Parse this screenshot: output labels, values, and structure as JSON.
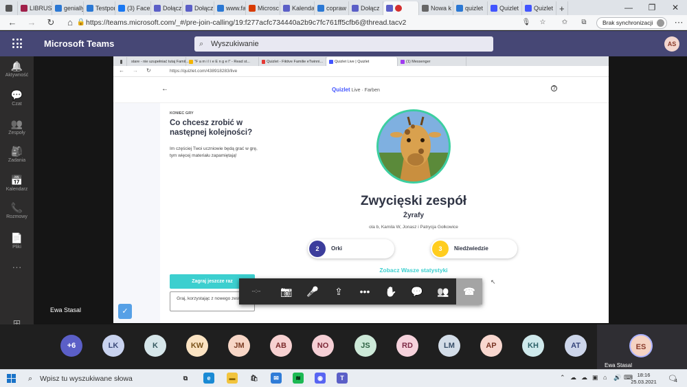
{
  "browser_tabs": [
    {
      "label": "",
      "icon": "tab-actions-icon",
      "color": "#555555"
    },
    {
      "label": "LIBRUS",
      "icon": "librus-icon",
      "color": "#a0204a"
    },
    {
      "label": "genially",
      "icon": "bing-icon",
      "color": "#2b78d4"
    },
    {
      "label": "Testpor",
      "icon": "bing-icon",
      "color": "#2b78d4"
    },
    {
      "label": "(3) Face",
      "icon": "facebook-icon",
      "color": "#1877f2"
    },
    {
      "label": "Dołącz",
      "icon": "teams-icon",
      "color": "#5b5fc7"
    },
    {
      "label": "Dołącz",
      "icon": "teams-icon",
      "color": "#5b5fc7"
    },
    {
      "label": "www.fa",
      "icon": "bing-icon",
      "color": "#2b78d4"
    },
    {
      "label": "Microsc",
      "icon": "office-icon",
      "color": "#d83b01"
    },
    {
      "label": "Kalenda",
      "icon": "teams-icon",
      "color": "#5b5fc7"
    },
    {
      "label": "copraw",
      "icon": "bing-icon",
      "color": "#2b78d4"
    },
    {
      "label": "Dołącz",
      "icon": "teams-icon",
      "color": "#5b5fc7"
    },
    {
      "label": "",
      "icon": "teams-icon",
      "color": "#5b5fc7",
      "active": true
    },
    {
      "label": "Nowa k",
      "icon": "new-tab-icon",
      "color": "#666666"
    },
    {
      "label": "quizlet",
      "icon": "bing-icon",
      "color": "#2b78d4"
    },
    {
      "label": "Quizlet",
      "icon": "quizlet-icon",
      "color": "#4255ff"
    },
    {
      "label": "Quizlet",
      "icon": "quizlet-icon",
      "color": "#4255ff"
    }
  ],
  "browser": {
    "url": "https://teams.microsoft.com/_#/pre-join-calling/19:f277acfc734440a2b9c7fc761ff5cfb6@thread.tacv2",
    "sync_label": "Brak synchronizacji",
    "new_tab": "+",
    "minimize": "—",
    "maximize": "❐",
    "close": "✕"
  },
  "teams": {
    "title": "Microsoft Teams",
    "search_placeholder": "Wyszukiwanie",
    "user_initials": "AS",
    "rail": [
      {
        "label": "Aktywność",
        "icon": "bell-icon",
        "glyph": "🔔"
      },
      {
        "label": "Czat",
        "icon": "chat-icon",
        "glyph": "💬"
      },
      {
        "label": "Zespoły",
        "icon": "teams-group-icon",
        "glyph": "👥"
      },
      {
        "label": "Zadania",
        "icon": "assignments-icon",
        "glyph": "🎒"
      },
      {
        "label": "Kalendarz",
        "icon": "calendar-icon",
        "glyph": "📅"
      },
      {
        "label": "Rozmowy",
        "icon": "phone-icon",
        "glyph": "📞"
      },
      {
        "label": "Pliki",
        "icon": "files-icon",
        "glyph": "📄"
      },
      {
        "label": "",
        "icon": "more-apps-icon",
        "glyph": "···"
      },
      {
        "label": "Aplikacje",
        "icon": "apps-icon",
        "glyph": "⊞"
      },
      {
        "label": "Pomoc",
        "icon": "help-icon",
        "glyph": "?"
      }
    ],
    "presenter_name": "Ewa Stasal"
  },
  "shared": {
    "inner_tabs": [
      {
        "label": "",
        "color": "#555555"
      },
      {
        "label": "stare - nie uzupełniać tutaj Famil...",
        "color": "#f4b400"
      },
      {
        "label": "\"F a m i l i e  E n g e l\" - Read st...",
        "color": "#f4b400"
      },
      {
        "label": "Quizlet - Fiktive Familie eTwinni...",
        "color": "#e53935"
      },
      {
        "label": "Quizlet Live | Quizlet",
        "color": "#4255ff",
        "active": true
      },
      {
        "label": "(1) Messenger",
        "color": "#a03cf0"
      }
    ],
    "inner_url": "https://quizlet.com/438918283/live",
    "logo_brand": "Quizlet",
    "logo_suffix": "Live · Farben",
    "game_over": "KONIEC GRY",
    "question": "Co chcesz zrobić w następnej kolejności?",
    "description": "Im częściej Twoi uczniowie będą grać w grę, tym więcej materiału zapamiętają!",
    "play_again": "Zagraj jeszcze raz",
    "new_set": "Graj, korzystając z nowego zestawu",
    "winner_title": "Zwycięski zespół",
    "winner_team": "Żyrafy",
    "winner_members": "ola b, Kamila W, Jonasz i Patrycja Gołkowice",
    "others": [
      {
        "rank": "2",
        "name": "Orki",
        "color": "#3c3d9c"
      },
      {
        "rank": "3",
        "name": "Niedźwiedzie",
        "color": "#ffcd1f"
      }
    ],
    "stats_link": "Zobacz Wasze statystyki"
  },
  "call_controls": [
    {
      "name": "call-timer",
      "glyph": "--:--"
    },
    {
      "name": "camera-off-icon",
      "glyph": "📷"
    },
    {
      "name": "mic-icon",
      "glyph": "🎤"
    },
    {
      "name": "share-screen-icon",
      "glyph": "⇪"
    },
    {
      "name": "more-actions-icon",
      "glyph": "•••"
    },
    {
      "name": "raise-hand-icon",
      "glyph": "✋"
    },
    {
      "name": "meeting-chat-icon",
      "glyph": "💬"
    },
    {
      "name": "participants-icon",
      "glyph": "👥"
    },
    {
      "name": "hang-up-icon",
      "glyph": "☎"
    }
  ],
  "participants": [
    {
      "initials": "+6",
      "bg": "#5b5fc7",
      "fg": "#ffffff"
    },
    {
      "initials": "LK",
      "bg": "#c9d3ef",
      "fg": "#3b4a7a"
    },
    {
      "initials": "K",
      "bg": "#d6e6ea",
      "fg": "#34585f"
    },
    {
      "initials": "KW",
      "bg": "#fbe3c2",
      "fg": "#7a5219"
    },
    {
      "initials": "JM",
      "bg": "#f7d6c6",
      "fg": "#7a3b22"
    },
    {
      "initials": "AB",
      "bg": "#f7d1d1",
      "fg": "#7b2a2a"
    },
    {
      "initials": "NO",
      "bg": "#f5cfd5",
      "fg": "#7d2a39"
    },
    {
      "initials": "JS",
      "bg": "#cde9d8",
      "fg": "#2c6041"
    },
    {
      "initials": "RD",
      "bg": "#f6d2dc",
      "fg": "#7d2a46"
    },
    {
      "initials": "LM",
      "bg": "#d3dde8",
      "fg": "#364d67"
    },
    {
      "initials": "AP",
      "bg": "#f8d7cf",
      "fg": "#7a3626"
    },
    {
      "initials": "KH",
      "bg": "#cfe9ec",
      "fg": "#2d6168"
    },
    {
      "initials": "AT",
      "bg": "#cdd6ea",
      "fg": "#34447a"
    }
  ],
  "self": {
    "initials": "ES",
    "name": "Ewa Stasal"
  },
  "taskbar": {
    "search_placeholder": "Wpisz tu wyszukiwane słowa",
    "apps": [
      {
        "name": "task-view-icon",
        "glyph": "⧉",
        "bg": "#e9edf2",
        "fg": "#333333"
      },
      {
        "name": "edge-icon",
        "glyph": "e",
        "bg": "#1a8ad4",
        "fg": "#ffffff"
      },
      {
        "name": "file-explorer-icon",
        "glyph": "▬",
        "bg": "#f2c43d",
        "fg": "#8a6200"
      },
      {
        "name": "store-icon",
        "glyph": "🛍",
        "bg": "#e9edf2",
        "fg": "#333333"
      },
      {
        "name": "mail-icon",
        "glyph": "✉",
        "bg": "#2f7cd7",
        "fg": "#ffffff"
      },
      {
        "name": "spotify-icon",
        "glyph": "≋",
        "bg": "#1db954",
        "fg": "#000000"
      },
      {
        "name": "discord-icon",
        "glyph": "◉",
        "bg": "#5865f2",
        "fg": "#ffffff"
      },
      {
        "name": "teams-app-icon",
        "glyph": "T",
        "bg": "#5b5fc7",
        "fg": "#ffffff"
      }
    ],
    "time": "18:16",
    "date": "25.03.2021",
    "notifications": "4"
  }
}
